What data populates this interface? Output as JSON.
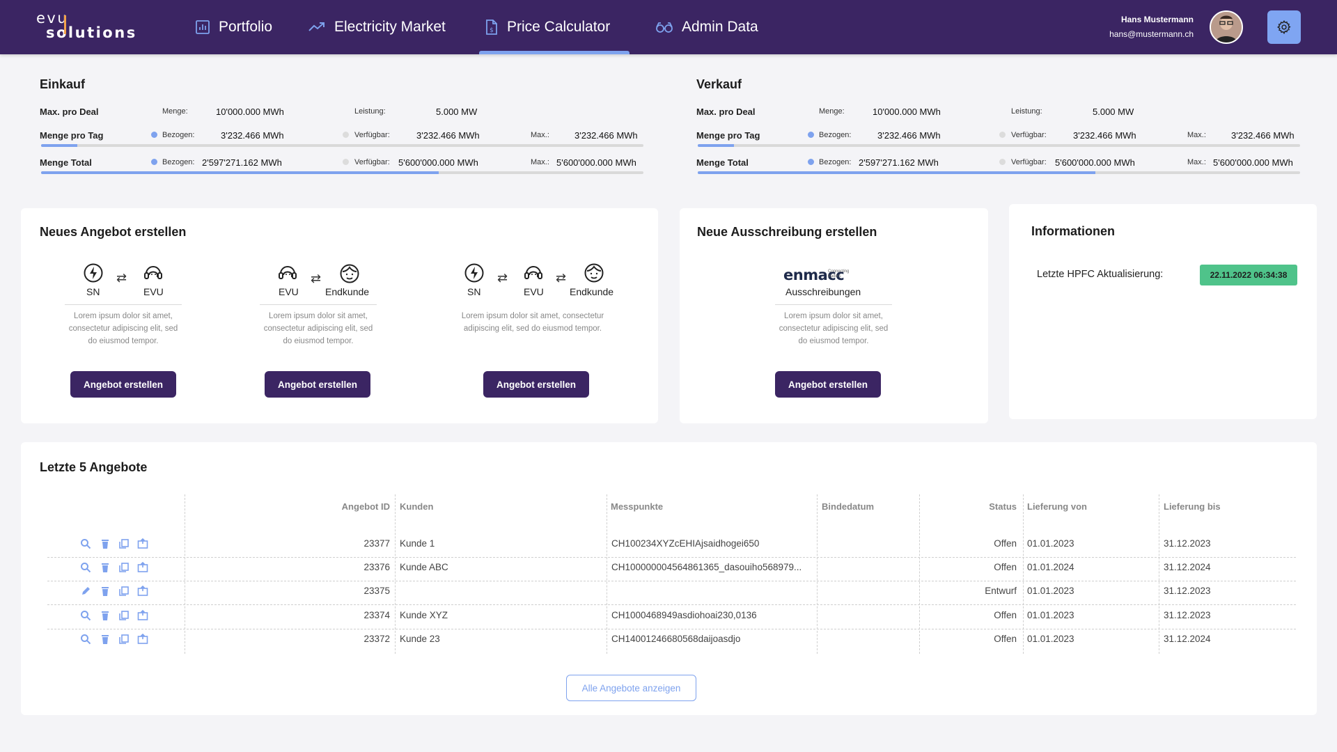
{
  "header": {
    "logo_line1": "evu",
    "logo_line2": "solutions",
    "nav": [
      {
        "label": "Portfolio",
        "icon": "chart-icon"
      },
      {
        "label": "Electricity Market",
        "icon": "trend-icon"
      },
      {
        "label": "Price Calculator",
        "icon": "document-dollar-icon",
        "active": true
      },
      {
        "label": "Admin Data",
        "icon": "glasses-icon"
      }
    ],
    "user_name": "Hans Mustermann",
    "user_email": "hans@mustermann.ch",
    "accent": "#7ea2ee",
    "bg": "#3b2563"
  },
  "einkauf": {
    "title": "Einkauf",
    "max_label": "Max. pro Deal",
    "menge_label": "Menge:",
    "menge_value": "10'000.000 MWh",
    "leistung_label": "Leistung:",
    "leistung_value": "5.000 MW",
    "tag_label": "Menge pro Tag",
    "tag_bezogen_label": "Bezogen:",
    "tag_bezogen": "3'232.466 MWh",
    "tag_verf_label": "Verfügbar:",
    "tag_verf": "3'232.466 MWh",
    "tag_max_label": "Max.:",
    "tag_max": "3'232.466 MWh",
    "tag_fill": 0.06,
    "total_label": "Menge Total",
    "total_bezogen_label": "Bezogen:",
    "total_bezogen": "2'597'271.162 MWh",
    "total_verf_label": "Verfügbar:",
    "total_verf": "5'600'000.000 MWh",
    "total_max_label": "Max.:",
    "total_max": "5'600'000.000 MWh",
    "total_fill": 0.66
  },
  "verkauf": {
    "title": "Verkauf",
    "max_label": "Max. pro Deal",
    "menge_label": "Menge:",
    "menge_value": "10'000.000 MWh",
    "leistung_label": "Leistung:",
    "leistung_value": "5.000 MW",
    "tag_label": "Menge pro Tag",
    "tag_bezogen_label": "Bezogen:",
    "tag_bezogen": "3'232.466 MWh",
    "tag_verf_label": "Verfügbar:",
    "tag_verf": "3'232.466 MWh",
    "tag_max_label": "Max.:",
    "tag_max": "3'232.466 MWh",
    "tag_fill": 0.06,
    "total_label": "Menge Total",
    "total_bezogen_label": "Bezogen:",
    "total_bezogen": "2'597'271.162 MWh",
    "total_verf_label": "Verfügbar:",
    "total_verf": "5'600'000.000 MWh",
    "total_max_label": "Max.:",
    "total_max": "5'600'000.000 MWh",
    "total_fill": 0.66
  },
  "neues_angebot": {
    "title": "Neues Angebot erstellen",
    "options": [
      {
        "labels": [
          "SN",
          "EVU"
        ],
        "desc": [
          "Lorem ipsum dolor sit amet,",
          "consectetur adipiscing elit, sed",
          "do eiusmod tempor."
        ],
        "button": "Angebot erstellen"
      },
      {
        "labels": [
          "EVU",
          "Endkunde"
        ],
        "desc": [
          "Lorem ipsum dolor sit amet,",
          "consectetur adipiscing elit, sed",
          "do eiusmod tempor."
        ],
        "button": "Angebot erstellen"
      },
      {
        "labels": [
          "SN",
          "EVU",
          "Endkunde"
        ],
        "desc": [
          "Lorem ipsum dolor sit amet, consectetur",
          "adipiscing elit, sed do eiusmod tempor."
        ],
        "button": "Angebot erstellen"
      }
    ]
  },
  "ausschreibung": {
    "title": "Neue Ausschreibung erstellen",
    "brand": "enmacc",
    "brand_tag1": "Connecting",
    "brand_tag2": "traders",
    "label": "Ausschreibungen",
    "desc": [
      "Lorem ipsum dolor sit amet,",
      "consectetur adipiscing elit, sed",
      "do eiusmod tempor."
    ],
    "button": "Angebot erstellen"
  },
  "informationen": {
    "title": "Informationen",
    "label": "Letzte HPFC Aktualisierung:",
    "value": "22.11.2022 06:34:38",
    "badge_color": "#4fc38a"
  },
  "letzte": {
    "title": "Letzte 5 Angebote",
    "columns": [
      "Angebot ID",
      "Kunden",
      "Messpunkte",
      "Bindedatum",
      "Status",
      "Lieferung von",
      "Lieferung bis"
    ],
    "rows": [
      {
        "first_icon": "search-icon",
        "id": "23377",
        "kunde": "Kunde 1",
        "messpunkte": "CH100234XYZcEHIAjsaidhogei650",
        "bindedatum": "",
        "status": "Offen",
        "von": "01.01.2023",
        "bis": "31.12.2023"
      },
      {
        "first_icon": "search-icon",
        "id": "23376",
        "kunde": "Kunde ABC",
        "messpunkte": "CH100000004564861365_dasouiho568979...",
        "bindedatum": "",
        "status": "Offen",
        "von": "01.01.2024",
        "bis": "31.12.2024"
      },
      {
        "first_icon": "pencil-icon",
        "id": "23375",
        "kunde": "",
        "messpunkte": "",
        "bindedatum": "",
        "status": "Entwurf",
        "von": "01.01.2023",
        "bis": "31.12.2023"
      },
      {
        "first_icon": "search-icon",
        "id": "23374",
        "kunde": "Kunde XYZ",
        "messpunkte": "CH1000468949asdiohoai230,0136",
        "bindedatum": "",
        "status": "Offen",
        "von": "01.01.2023",
        "bis": "31.12.2023"
      },
      {
        "first_icon": "search-icon",
        "id": "23372",
        "kunde": "Kunde 23",
        "messpunkte": "CH14001246680568daijoasdjo",
        "bindedatum": "",
        "status": "Offen",
        "von": "01.01.2023",
        "bis": "31.12.2024"
      }
    ],
    "button": "Alle Angebote anzeigen"
  }
}
